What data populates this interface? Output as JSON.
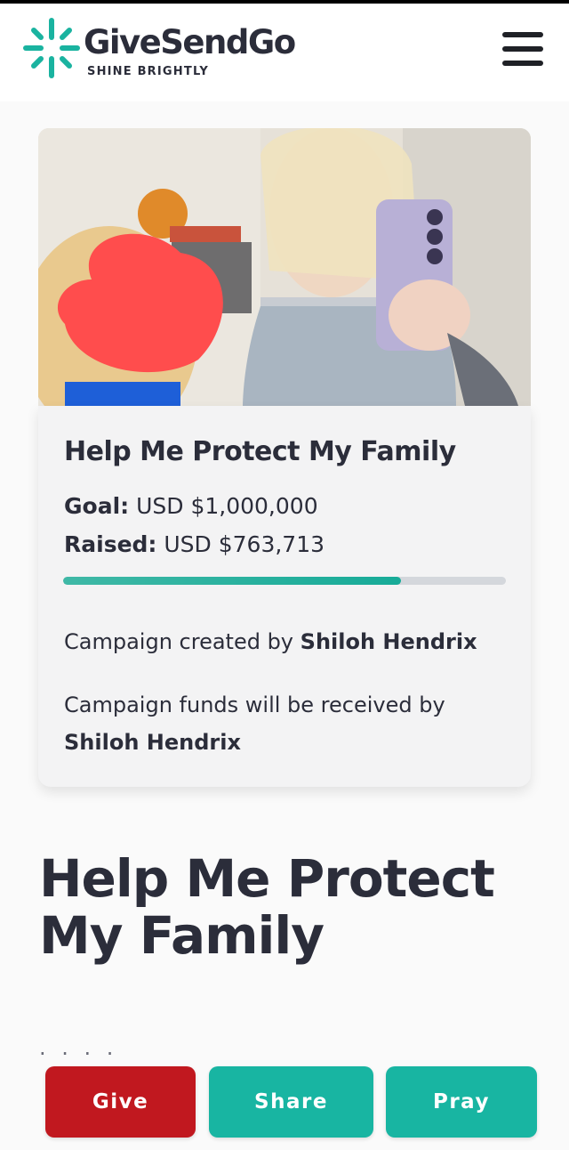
{
  "brand": {
    "name": "GiveSendGo",
    "tagline": "SHINE BRIGHTLY",
    "color": "#1ab3a0"
  },
  "header": {
    "menu_icon": "hamburger-menu-icon"
  },
  "campaign": {
    "title": "Help Me Protect My Family",
    "goal_label": "Goal:",
    "goal_value": "USD $1,000,000",
    "raised_label": "Raised:",
    "raised_value": "USD $763,713",
    "progress_fraction": 0.764,
    "created_by_text": "Campaign created by",
    "created_by_name": "Shiloh Hendrix",
    "funds_text": "Campaign funds will be received by",
    "funds_name": "Shiloh Hendrix"
  },
  "main": {
    "heading": "Help Me Protect My Family"
  },
  "actions": {
    "give_label": "Give",
    "share_label": "Share",
    "pray_label": "Pray",
    "give_color": "#c1181f",
    "share_color": "#18b5a2",
    "pray_color": "#18b5a2"
  }
}
